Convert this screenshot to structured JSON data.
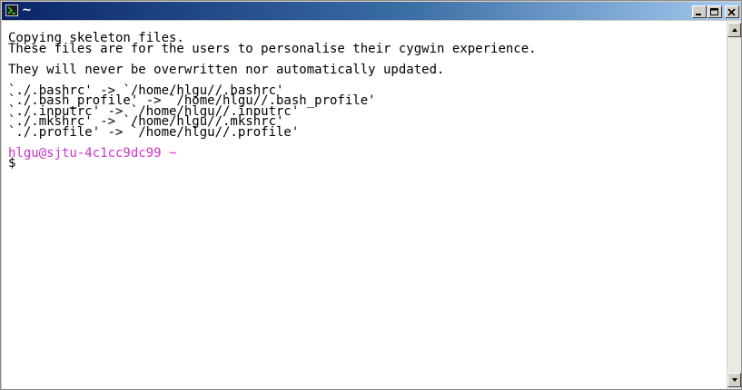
{
  "window": {
    "title": "~",
    "minimize_icon": "minimize-icon",
    "maximize_icon": "maximize-icon",
    "close_icon": "close-icon"
  },
  "terminal": {
    "lines": [
      "Copying skeleton files.",
      "These files are for the users to personalise their cygwin experience.",
      "",
      "They will never be overwritten nor automatically updated.",
      "",
      "`./.bashrc' -> `/home/hlgu//.bashrc'",
      "`./.bash_profile' -> `/home/hlgu//.bash_profile'",
      "`./.inputrc' -> `/home/hlgu//.inputrc'",
      "`./.mkshrc' -> `/home/hlgu//.mkshrc'",
      "`./.profile' -> `/home/hlgu//.profile'",
      ""
    ],
    "prompt_user_host": "hlgu@sjtu-4c1cc9dc99",
    "prompt_dir": "~",
    "prompt_symbol": "$"
  },
  "colors": {
    "titlebar_start": "#0a246a",
    "titlebar_end": "#a6caf0",
    "prompt": "#cc33cc",
    "text": "#000000",
    "background": "#ffffff"
  }
}
